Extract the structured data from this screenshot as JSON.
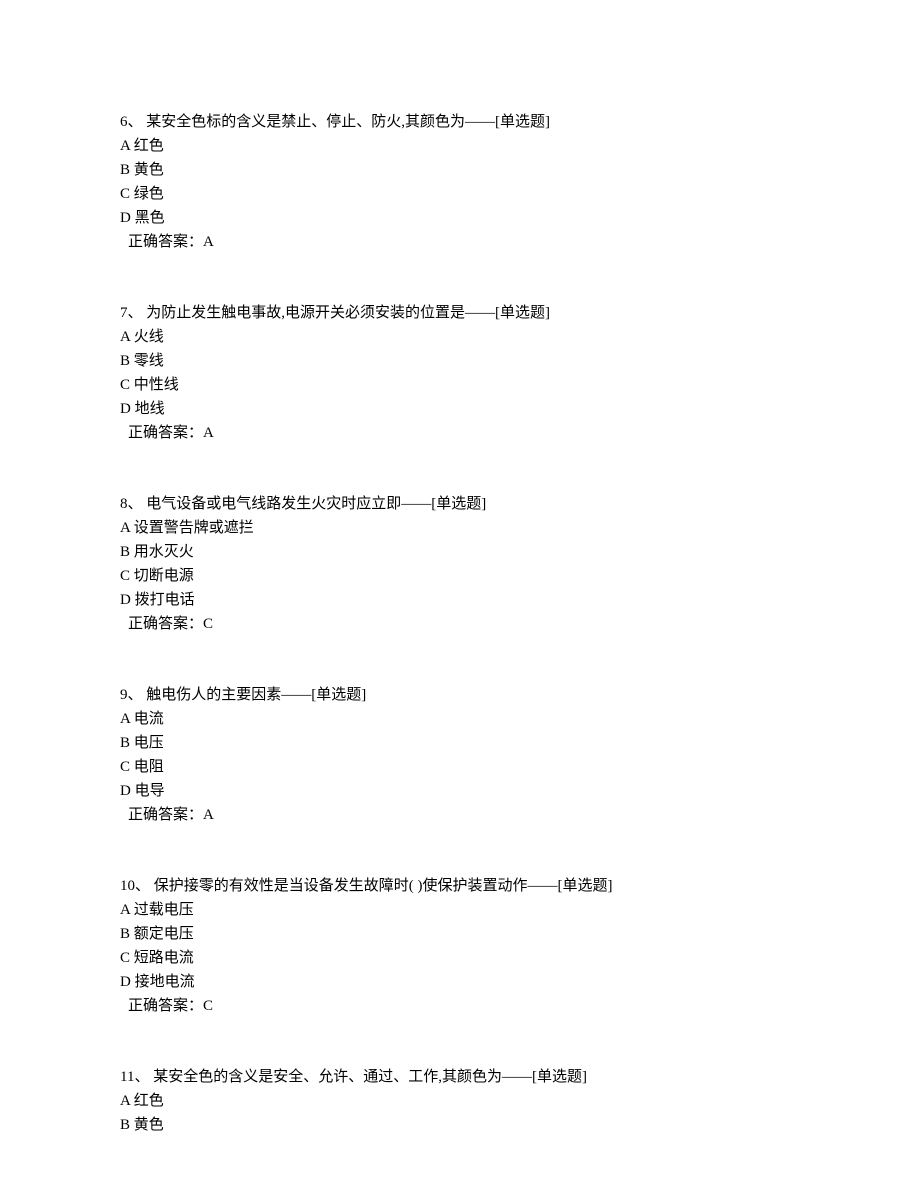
{
  "questions": [
    {
      "number": "6、",
      "text": "某安全色标的含义是禁止、停止、防火,其颜色为——[单选题]",
      "options": [
        "A 红色",
        "B 黄色",
        "C 绿色",
        "D 黑色"
      ],
      "answer": "正确答案：A"
    },
    {
      "number": "7、",
      "text": "为防止发生触电事故,电源开关必须安装的位置是——[单选题]",
      "options": [
        "A 火线",
        "B 零线",
        "C 中性线",
        "D 地线"
      ],
      "answer": "正确答案：A"
    },
    {
      "number": "8、",
      "text": "电气设备或电气线路发生火灾时应立即——[单选题]",
      "options": [
        "A 设置警告牌或遮拦",
        "B 用水灭火",
        "C 切断电源",
        "D 拨打电话"
      ],
      "answer": "正确答案：C"
    },
    {
      "number": "9、",
      "text": "触电伤人的主要因素——[单选题]",
      "options": [
        "A 电流",
        "B 电压",
        "C 电阻",
        "D 电导"
      ],
      "answer": "正确答案：A"
    },
    {
      "number": "10、",
      "text": "保护接零的有效性是当设备发生故障时( )使保护装置动作——[单选题]",
      "options": [
        "A 过载电压",
        "B 额定电压",
        "C 短路电流",
        "D 接地电流"
      ],
      "answer": "正确答案：C"
    },
    {
      "number": "11、",
      "text": "某安全色的含义是安全、允许、通过、工作,其颜色为——[单选题]",
      "options": [
        "A 红色",
        "B 黄色"
      ],
      "answer": ""
    }
  ]
}
